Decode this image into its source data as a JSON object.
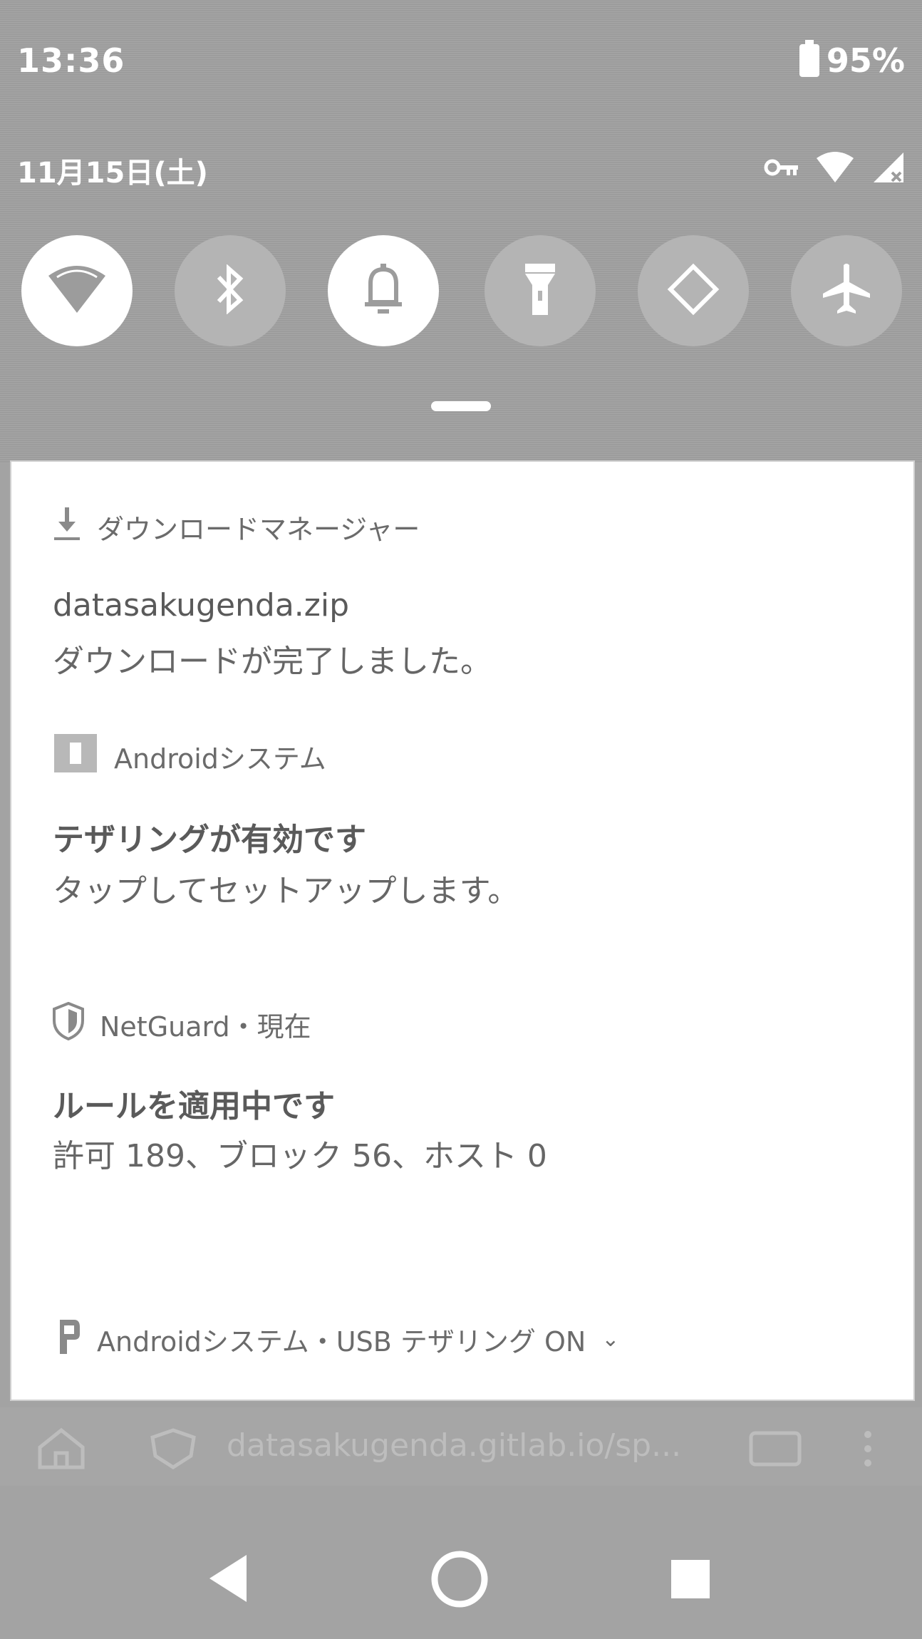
{
  "status_bar": {
    "time": "13:36",
    "battery": "95%"
  },
  "header": {
    "date": "11月15日(土)"
  },
  "quick_settings": [
    {
      "name": "wifi",
      "icon": "wifi-icon",
      "active": true
    },
    {
      "name": "bluetooth",
      "icon": "bluetooth-icon",
      "active": false
    },
    {
      "name": "sound",
      "icon": "bell-icon",
      "active": true
    },
    {
      "name": "flashlight",
      "icon": "flashlight-icon",
      "active": false
    },
    {
      "name": "auto-rotate",
      "icon": "rotate-icon",
      "active": false
    },
    {
      "name": "airplane",
      "icon": "airplane-icon",
      "active": false
    }
  ],
  "notifications": [
    {
      "app": "ダウンロードマネージャー",
      "icon": "download-icon",
      "title": "datasakugenda.zip",
      "text": "ダウンロードが完了しました。"
    },
    {
      "app": "Androidシステム",
      "icon": "android-system-icon",
      "title": "テザリングが有効です",
      "text": "タップしてセットアップします。"
    },
    {
      "app": "NetGuard・現在",
      "icon": "shield-icon",
      "title": "ルールを適用中です",
      "text": "許可 189、ブロック 56、ホスト 0"
    },
    {
      "app": "Androidシステム・USB テザリング ON",
      "icon": "usb-icon"
    }
  ],
  "browser": {
    "url": "datasakugenda.gitlab.io/sp..."
  },
  "colors": {
    "shade": "#9c9c9c",
    "panel": "#ffffff",
    "toggle_on": "#ffffff",
    "toggle_off": "#b4b4b4"
  }
}
